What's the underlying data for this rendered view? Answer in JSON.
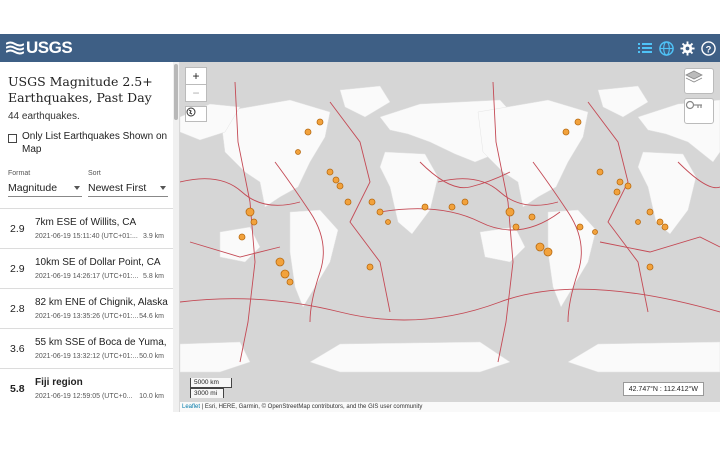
{
  "header": {
    "logo_text": "USGS",
    "icons": [
      "list-icon",
      "globe-icon",
      "gear-icon",
      "help-icon"
    ]
  },
  "sidebar": {
    "title": "USGS Magnitude 2.5+ Earthquakes, Past Day",
    "count_text": "44 earthquakes.",
    "only_list_label": "Only List Earthquakes Shown on Map",
    "format": {
      "label": "Format",
      "value": "Magnitude"
    },
    "sort": {
      "label": "Sort",
      "value": "Newest First"
    },
    "earthquakes": [
      {
        "mag": "2.9",
        "place": "7km ESE of Willits, CA",
        "time": "2021-06-19 15:11:40 (UTC+01:...",
        "depth": "3.9 km"
      },
      {
        "mag": "2.9",
        "place": "10km SE of Dollar Point, CA",
        "time": "2021-06-19 14:26:17 (UTC+01:...",
        "depth": "5.8 km"
      },
      {
        "mag": "2.8",
        "place": "82 km ENE of Chignik, Alaska",
        "time": "2021-06-19 13:35:26 (UTC+01:...",
        "depth": "54.6 km"
      },
      {
        "mag": "3.6",
        "place": "55 km SSE of Boca de Yuma, ...",
        "time": "2021-06-19 13:32:12 (UTC+01:...",
        "depth": "50.0 km"
      },
      {
        "mag": "5.8",
        "place": "Fiji region",
        "time": "2021-06-19 12:59:05 (UTC+0...",
        "depth": "10.0 km"
      }
    ]
  },
  "map": {
    "zoom_in": "+",
    "zoom_out": "−",
    "scale_km": "5000 km",
    "scale_mi": "3000 mi",
    "coords": "42.747°N : 112.412°W",
    "attribution_link": "Leaflet",
    "attribution_text": " | Esri, HERE, Garmin, © OpenStreetMap contributors, and the GIS user community"
  },
  "colors": {
    "header_bg": "#3e5f85",
    "ocean": "#d6d6d6",
    "land": "#fafafa",
    "plate_boundary": "#c44a55",
    "quake_fill": "#f2a23c",
    "quake_stroke": "#b86b12"
  }
}
